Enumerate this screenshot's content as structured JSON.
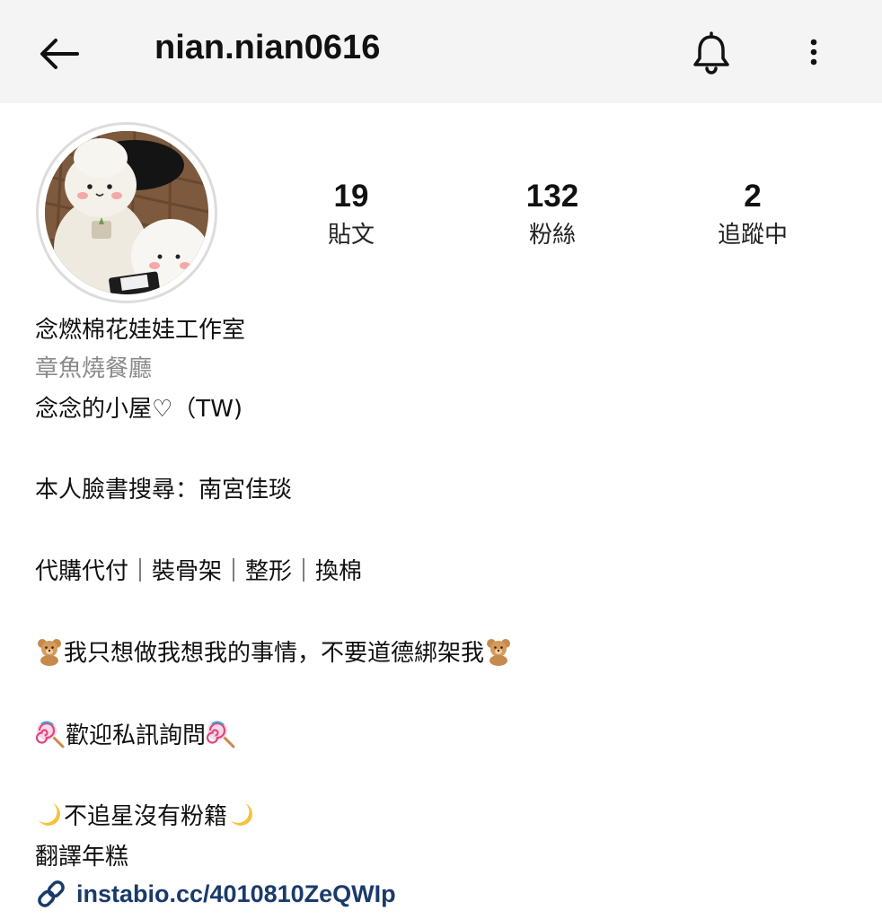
{
  "header": {
    "username": "nian.nian0616",
    "back_icon": "arrow-left-icon",
    "bell_icon": "bell-icon",
    "more_icon": "more-vertical-icon"
  },
  "stats": [
    {
      "value": "19",
      "label": "貼文"
    },
    {
      "value": "132",
      "label": "粉絲"
    },
    {
      "value": "2",
      "label": "追蹤中"
    }
  ],
  "profile": {
    "name": "念燃棉花娃娃工作室",
    "category": "章魚燒餐廳",
    "bio": {
      "line1": "念念的小屋♡（TW)",
      "line2": "本人臉書搜尋：南宮佳琰",
      "line3": "代購代付｜裝骨架｜整形｜換棉",
      "line4": "我只想做我想我的事情，不要道德綁架我",
      "line5": "歡迎私訊詢問",
      "line6": "不追星沒有粉籍",
      "line7": "翻譯年糕"
    },
    "link": "instabio.cc/4010810ZeQWIp"
  },
  "colors": {
    "header_bg": "#f4f4f4",
    "link": "#1a3a6b",
    "muted": "#8a8a8a"
  }
}
